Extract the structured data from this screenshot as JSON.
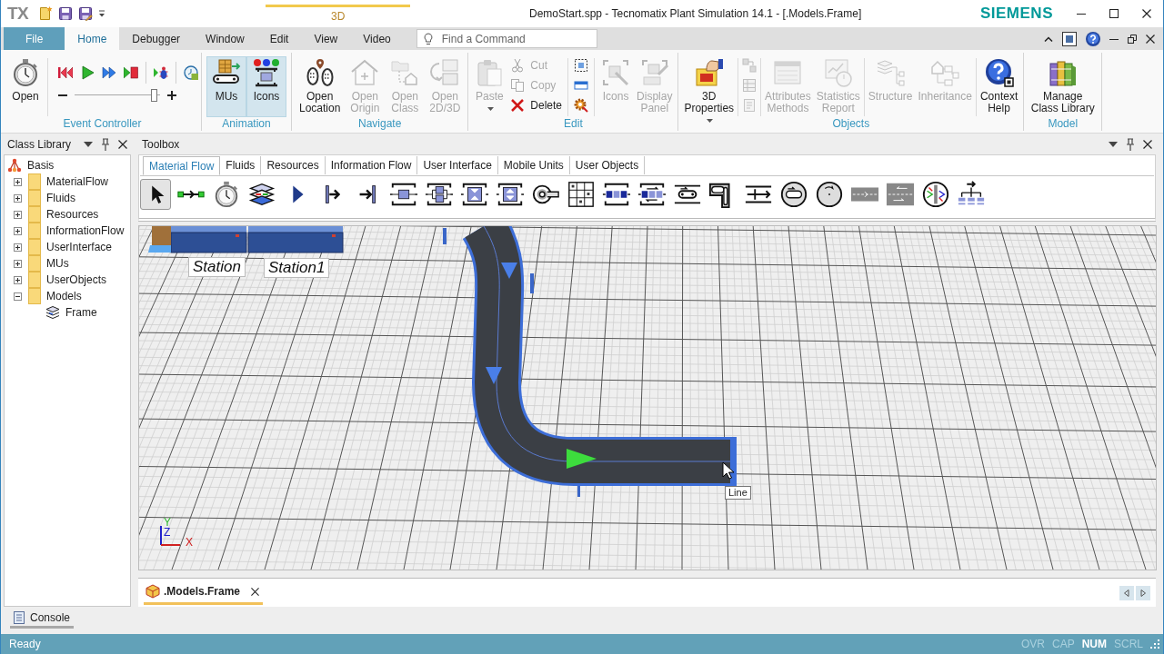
{
  "window": {
    "app_logo": "TX",
    "context_tab": "3D",
    "title": "DemoStart.spp - Tecnomatix Plant Simulation 14.1 - [.Models.Frame]",
    "brand": "SIEMENS"
  },
  "ribbon_tabs": [
    {
      "label": "File",
      "kind": "file",
      "selected": false
    },
    {
      "label": "Home",
      "kind": "tab",
      "selected": true
    },
    {
      "label": "Debugger",
      "kind": "tab",
      "selected": false
    },
    {
      "label": "Window",
      "kind": "tab",
      "selected": false
    },
    {
      "label": "Edit",
      "kind": "tab",
      "selected": false
    },
    {
      "label": "View",
      "kind": "tab",
      "selected": false
    },
    {
      "label": "Video",
      "kind": "tab",
      "selected": false
    }
  ],
  "search": {
    "placeholder": "Find a Command"
  },
  "ribbon": {
    "groups": [
      {
        "label": "Event Controller",
        "items": [
          {
            "kind": "large",
            "label": "Open",
            "disabled": false
          },
          {
            "kind": "separator"
          },
          {
            "kind": "transport",
            "buttons": [
              {
                "kind": "button",
                "disabled": false
              },
              {
                "kind": "button",
                "disabled": false
              },
              {
                "kind": "button",
                "disabled": false
              },
              {
                "kind": "button",
                "disabled": false
              },
              {
                "kind": "separator"
              },
              {
                "kind": "button",
                "disabled": false
              },
              {
                "kind": "separator"
              },
              {
                "kind": "button",
                "disabled": false
              }
            ],
            "slider": {
              "level": 0.97
            }
          }
        ]
      },
      {
        "label": "Animation",
        "items": [
          {
            "kind": "large",
            "label": "MUs",
            "disabled": false,
            "on": true
          },
          {
            "kind": "large",
            "label": "Icons",
            "disabled": false,
            "on": true
          }
        ]
      },
      {
        "label": "Navigate",
        "items": [
          {
            "kind": "large",
            "label": "Open Location",
            "disabled": false
          },
          {
            "kind": "large",
            "label": "Open Origin",
            "disabled": true
          },
          {
            "kind": "large",
            "label": "Open Class",
            "disabled": true
          },
          {
            "kind": "large",
            "label": "Open 2D/3D",
            "disabled": true
          }
        ]
      },
      {
        "label": "Edit",
        "items": [
          {
            "kind": "large",
            "label": "Paste",
            "disabled": true,
            "dropdown": true
          },
          {
            "kind": "stack",
            "buttons": [
              {
                "label": "Cut",
                "disabled": true
              },
              {
                "label": "Copy",
                "disabled": true
              },
              {
                "label": "Delete",
                "disabled": false
              }
            ]
          },
          {
            "kind": "separator"
          },
          {
            "kind": "stack",
            "buttons": [
              {
                "disabled": false
              },
              {
                "disabled": false
              },
              {
                "disabled": false
              }
            ]
          },
          {
            "kind": "separator"
          },
          {
            "kind": "large",
            "label": "Icons",
            "disabled": true
          },
          {
            "kind": "large",
            "label": "Display Panel",
            "disabled": true
          }
        ]
      },
      {
        "label": "Objects",
        "items": [
          {
            "kind": "large",
            "label": "3D Properties",
            "disabled": false,
            "dropdown": true
          },
          {
            "kind": "separator"
          },
          {
            "kind": "stack",
            "buttons": [
              {
                "disabled": true
              },
              {
                "disabled": true
              },
              {
                "disabled": true
              }
            ]
          },
          {
            "kind": "separator"
          },
          {
            "kind": "large",
            "label": "Attributes Methods",
            "disabled": true
          },
          {
            "kind": "large",
            "label": "Statistics Report",
            "disabled": true
          },
          {
            "kind": "separator"
          },
          {
            "kind": "large",
            "label": "Structure",
            "disabled": true
          },
          {
            "kind": "large",
            "label": "Inheritance",
            "disabled": true
          },
          {
            "kind": "separator"
          },
          {
            "kind": "large",
            "label": "Context Help",
            "disabled": false
          }
        ]
      },
      {
        "label": "Model",
        "items": [
          {
            "kind": "large",
            "label": "Manage Class Library",
            "disabled": false
          }
        ]
      }
    ]
  },
  "class_library": {
    "title": "Class Library",
    "tree": [
      {
        "label": "Basis",
        "kind": "library",
        "children": [
          {
            "label": "MaterialFlow",
            "kind": "folder",
            "expanded": false
          },
          {
            "label": "Fluids",
            "kind": "folder",
            "expanded": false
          },
          {
            "label": "Resources",
            "kind": "folder",
            "expanded": false
          },
          {
            "label": "InformationFlow",
            "kind": "folder",
            "expanded": false
          },
          {
            "label": "UserInterface",
            "kind": "folder",
            "expanded": false
          },
          {
            "label": "MUs",
            "kind": "folder",
            "expanded": false
          },
          {
            "label": "UserObjects",
            "kind": "folder",
            "expanded": false
          },
          {
            "label": "Models",
            "kind": "folder",
            "expanded": true,
            "children": [
              {
                "label": "Frame",
                "kind": "frame"
              }
            ]
          }
        ]
      }
    ]
  },
  "toolbox": {
    "title": "Toolbox",
    "tabs": [
      {
        "label": "Material Flow",
        "selected": true
      },
      {
        "label": "Fluids",
        "selected": false
      },
      {
        "label": "Resources",
        "selected": false
      },
      {
        "label": "Information Flow",
        "selected": false
      },
      {
        "label": "User Interface",
        "selected": false
      },
      {
        "label": "Mobile Units",
        "selected": false
      },
      {
        "label": "User Objects",
        "selected": false
      }
    ],
    "tools": [
      {
        "selected": true
      },
      {
        "selected": false
      },
      {
        "selected": false
      },
      {
        "selected": false
      },
      {
        "selected": false
      },
      {
        "selected": false
      },
      {
        "selected": false
      },
      {
        "selected": false
      },
      {
        "selected": false
      },
      {
        "selected": false
      },
      {
        "selected": false
      },
      {
        "selected": false
      },
      {
        "selected": false
      },
      {
        "selected": false
      },
      {
        "selected": false
      },
      {
        "selected": false
      },
      {
        "selected": false
      },
      {
        "selected": false
      },
      {
        "selected": false
      },
      {
        "selected": false
      },
      {
        "selected": false
      },
      {
        "selected": false
      },
      {
        "selected": false
      },
      {
        "selected": false
      }
    ]
  },
  "view_3d": {
    "stations": [
      {
        "label": "Station"
      },
      {
        "label": "Station1"
      }
    ],
    "markers": [
      {
        "color": "#4a7fe8"
      },
      {
        "color": "#4a7fe8"
      },
      {
        "color": "#3ddc3d"
      }
    ],
    "tooltip": "Line",
    "axes": {
      "x": "X",
      "y": "Y",
      "z": "Z"
    }
  },
  "document_tabs": [
    {
      "label": ".Models.Frame",
      "selected": true
    }
  ],
  "bottom_tabs": [
    {
      "label": "Console",
      "selected": true
    }
  ],
  "status_bar": {
    "text": "Ready",
    "indicators": [
      {
        "label": "OVR",
        "on": false
      },
      {
        "label": "CAP",
        "on": false
      },
      {
        "label": "NUM",
        "on": true
      },
      {
        "label": "SCRL",
        "on": false
      }
    ]
  }
}
